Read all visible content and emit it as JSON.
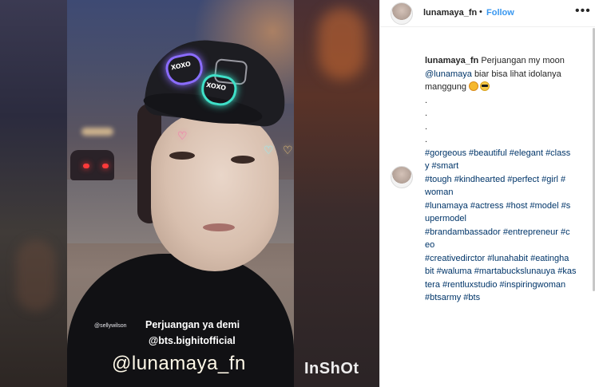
{
  "media": {
    "overlay_tag": "@sellywilson",
    "overlay_line1": "Perjuangan ya demi",
    "overlay_line2": "@bts.bighitofficial",
    "overlay_handle": "@lunamaya_fn",
    "watermark": "InShOt",
    "sticker_text_1": "XOXO",
    "sticker_text_2": "XOXO"
  },
  "header": {
    "username": "lunamaya_fn",
    "separator": "•",
    "follow_label": "Follow",
    "more_icon": "•••"
  },
  "caption": {
    "username": "lunamaya_fn",
    "text_before_mention": "Perjuangan my moon",
    "mention": "@lunamaya",
    "text_after_mention": "biar bisa lihat idolanya manggung",
    "emojis": [
      "star-struck-emoji",
      "sunglasses-emoji"
    ],
    "dots": [
      ".",
      ".",
      ".",
      "."
    ],
    "hashtag_lines": [
      "#gorgeous #beautiful #elegant #class",
      "y #smart",
      "#tough #kindhearted #perfect #girl #",
      "woman",
      "#lunamaya #actress #host #model #s",
      "upermodel",
      "#brandambassador #entrepreneur #c",
      "eo",
      "#creativedirctor #lunahabit #eatingha",
      "bit #waluma #martabuckslunauya #kas",
      "tera #rentluxstudio #inspiringwoman",
      "#btsarmy #bts"
    ]
  },
  "colors": {
    "link": "#003569",
    "follow": "#3897f0",
    "text": "#262626",
    "border": "#efefef"
  }
}
